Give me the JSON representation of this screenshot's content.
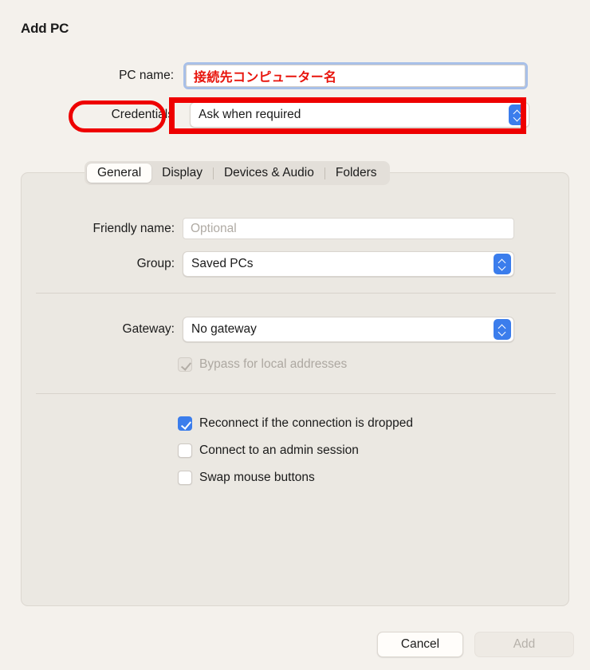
{
  "dialog": {
    "title": "Add PC"
  },
  "top_form": {
    "pc_name": {
      "label": "PC name:",
      "value": "接続先コンピューター名",
      "placeholder": ""
    },
    "credentials": {
      "label": "Credentials",
      "selected": "Ask when required"
    }
  },
  "annotations": {
    "accent_color": "#ee0000",
    "credentials_label_highlight": "Credentials",
    "credentials_field_highlight": "Ask when required"
  },
  "tabs": [
    {
      "label": "General",
      "selected": true
    },
    {
      "label": "Display",
      "selected": false
    },
    {
      "label": "Devices & Audio",
      "selected": false
    },
    {
      "label": "Folders",
      "selected": false
    }
  ],
  "general_panel": {
    "friendly_name": {
      "label": "Friendly name:",
      "value": "",
      "placeholder": "Optional"
    },
    "group": {
      "label": "Group:",
      "selected": "Saved PCs"
    },
    "gateway": {
      "label": "Gateway:",
      "selected": "No gateway"
    },
    "bypass": {
      "label": "Bypass for local addresses",
      "checked": true,
      "disabled": true
    },
    "options": [
      {
        "label": "Reconnect if the connection is dropped",
        "checked": true
      },
      {
        "label": "Connect to an admin session",
        "checked": false
      },
      {
        "label": "Swap mouse buttons",
        "checked": false
      }
    ]
  },
  "footer": {
    "cancel_label": "Cancel",
    "add_label": "Add",
    "add_disabled": true
  },
  "colors": {
    "window_background": "#f4f1ec",
    "panel_background": "#ebe8e2",
    "accent_blue": "#3b7dec",
    "focus_ring": "#a8c0e8",
    "annotation_red": "#ee0000",
    "text_red": "#e8140c"
  }
}
